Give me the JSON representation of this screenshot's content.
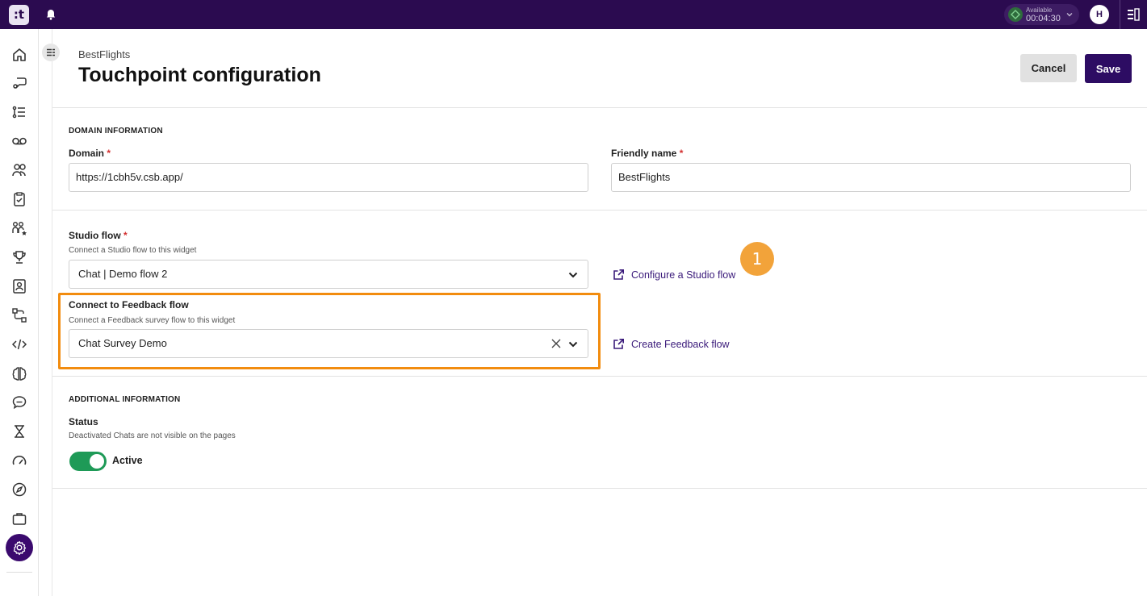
{
  "topbar": {
    "logo_text": ":t",
    "status_label": "Available",
    "status_timer": "00:04:30",
    "avatar_initial": "H",
    "accent": "#2b0b50"
  },
  "sidebar": {
    "items": [
      {
        "icon": "home-icon"
      },
      {
        "icon": "conversations-icon"
      },
      {
        "icon": "list-icon"
      },
      {
        "icon": "voicemail-icon"
      },
      {
        "icon": "agents-icon"
      },
      {
        "icon": "clipboard-icon"
      },
      {
        "icon": "team-icon"
      },
      {
        "icon": "trophy-icon"
      },
      {
        "icon": "contact-card-icon"
      },
      {
        "icon": "flow-icon"
      },
      {
        "icon": "code-icon"
      },
      {
        "icon": "brain-icon"
      },
      {
        "icon": "chat-icon"
      },
      {
        "icon": "hourglass-icon"
      },
      {
        "icon": "gauge-icon"
      },
      {
        "icon": "compass-icon"
      },
      {
        "icon": "briefcase-icon"
      },
      {
        "icon": "settings-icon",
        "active": true
      }
    ]
  },
  "header": {
    "breadcrumb": "BestFlights",
    "title": "Touchpoint configuration",
    "cancel_label": "Cancel",
    "save_label": "Save"
  },
  "domain_section": {
    "title": "DOMAIN INFORMATION",
    "domain_label": "Domain",
    "domain_value": "https://1cbh5v.csb.app/",
    "friendly_label": "Friendly name",
    "friendly_value": "BestFlights",
    "required_mark": "*"
  },
  "flow_section": {
    "studio_label": "Studio flow",
    "studio_help": "Connect a Studio flow to this widget",
    "studio_value": "Chat | Demo flow 2",
    "studio_link": "Configure a Studio flow",
    "feedback_label": "Connect to Feedback flow",
    "feedback_help": "Connect a Feedback survey flow to this widget",
    "feedback_value": "Chat Survey Demo",
    "feedback_link": "Create Feedback flow",
    "callout_number": "1",
    "highlight_color": "#f28c0f"
  },
  "additional_section": {
    "title": "ADDITIONAL INFORMATION",
    "status_label": "Status",
    "status_help": "Deactivated Chats are not visible on the pages",
    "toggle_label": "Active",
    "toggle_on": true,
    "toggle_color": "#1e9a57"
  }
}
